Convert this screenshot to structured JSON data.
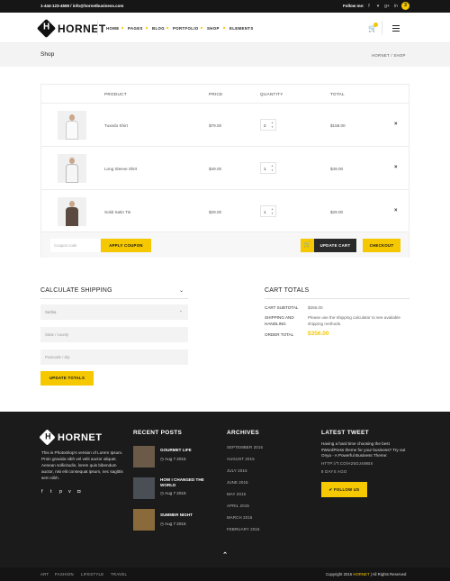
{
  "topbar": {
    "contact": "1-444-123-4559 / info@hornetbusiness.com",
    "follow_label": "Follow me:",
    "social_icons": [
      "facebook-icon",
      "twitter-icon",
      "google-plus-icon",
      "linkedin-icon"
    ],
    "badge": "3"
  },
  "header": {
    "logo": "HORNET",
    "nav": [
      "HOME",
      "PAGES",
      "BLOG",
      "PORTFOLIO",
      "SHOP",
      "ELEMENTS"
    ]
  },
  "titlebar": {
    "title": "Shop",
    "breadcrumb": "HORNET / SHOP"
  },
  "cart": {
    "headers": {
      "product": "PRODUCT",
      "price": "PRICE",
      "quantity": "QUANTITY",
      "total": "TOTAL"
    },
    "items": [
      {
        "name": "Tuxedo Shirt",
        "price": "$79.00",
        "qty": "2",
        "total": "$158.00"
      },
      {
        "name": "Long Sleeve Shirt",
        "price": "$49.00",
        "qty": "1",
        "total": "$49.00"
      },
      {
        "name": "Solid Satin Tie",
        "price": "$29.00",
        "qty": "1",
        "total": "$29.00"
      }
    ],
    "coupon_placeholder": "Coupon code",
    "apply_coupon": "APPLY COUPON",
    "update_cart": "UPDATE CART",
    "checkout": "CHECKOUT"
  },
  "shipping": {
    "title": "CALCULATE SHIPPING",
    "country": "Serbia",
    "state_placeholder": "State / county",
    "postcode_placeholder": "Postcode / Zip",
    "update_totals": "UPDATE TOTALS"
  },
  "totals": {
    "title": "CART TOTALS",
    "subtotal_label": "CART SUBTOTAL",
    "subtotal_value": "$356.00",
    "shipping_label_1": "SHIPPING AND",
    "shipping_label_2": "HANDLING",
    "shipping_note_1": "Please use the shipping calculator to see available",
    "shipping_note_2": "shipping methods.",
    "order_total_label": "ORDER TOTAL",
    "order_total_value": "$356.00"
  },
  "footer": {
    "logo": "HORNET",
    "about": "This is Photoshop's version of Lorem Ipsum. Proin gravida nibh vel velit auctor aliquet. Aenean sollicitudin, lorem quis bibendum auctor, nisi elit consequat ipsum, nec sagittis sem nibh.",
    "recent_posts_title": "RECENT POSTS",
    "posts": [
      {
        "title": "GOURMET LIFE",
        "date": "Aug 7 2015"
      },
      {
        "title": "HOW I CHANGED THE WORLD",
        "date": "Aug 7 2015"
      },
      {
        "title": "SUMMER NIGHT",
        "date": "Aug 7 2015"
      }
    ],
    "archives_title": "ARCHIVES",
    "archives": [
      "SEPTEMBER 2015",
      "AUGUST 2015",
      "JULY 2015",
      "JUNE 2015",
      "MAY 2015",
      "APRIL 2015",
      "MARCH 2015",
      "FEBRUARY 2015"
    ],
    "tweet_title": "LATEST TWEET",
    "tweet": "Having a hard time choosing the best #WordPress theme for your business? Try out Onya - A Powerful Business Theme:",
    "tweet_link": "HTTP://T.CO/H25OJ4WBX",
    "tweet_ago": "8 DAYS AGO",
    "follow_us": "FOLLOW US"
  },
  "bottombar": {
    "links": [
      "ART",
      "FASHION",
      "LIFESTYLE",
      "TRAVEL"
    ],
    "copyright_pre": "Copyright 2015 ",
    "copyright_brand": "HORNET",
    "copyright_post": " | All Rights Reserved"
  },
  "colors": {
    "accent": "#f5c800",
    "dark": "#1b1b1b"
  }
}
